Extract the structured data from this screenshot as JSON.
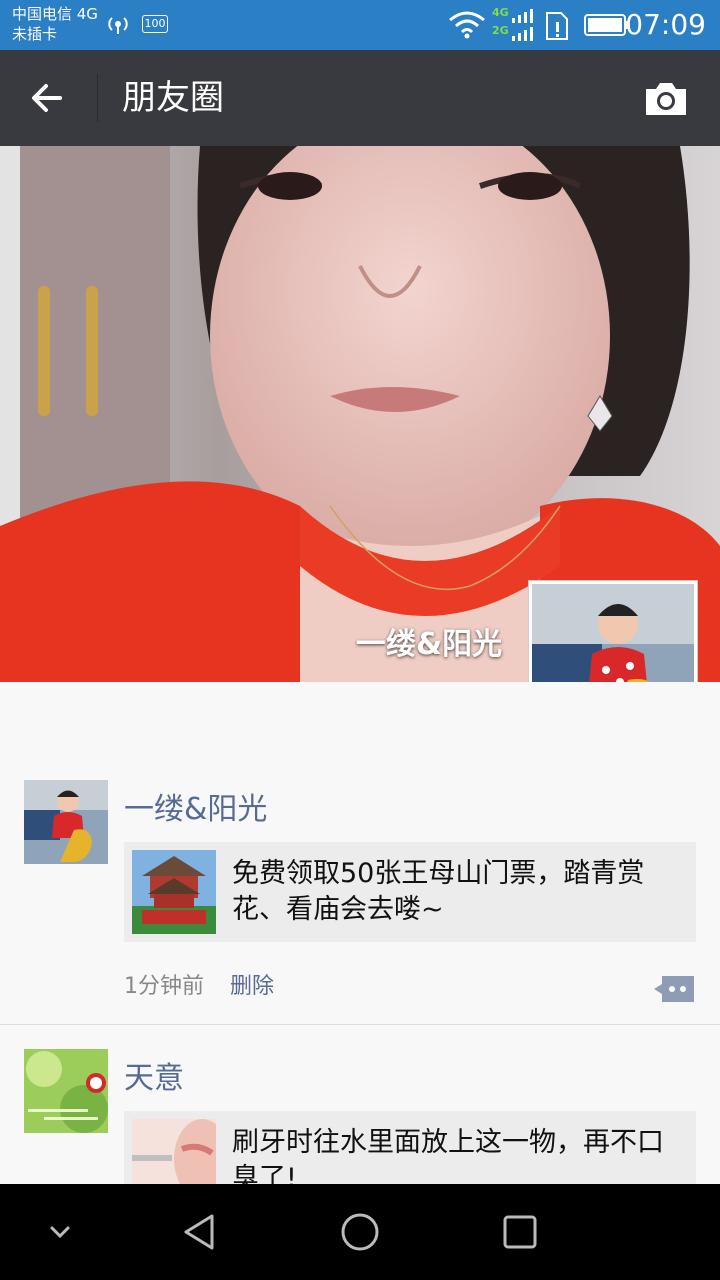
{
  "status_bar": {
    "carrier_line1": "中国电信 4G",
    "carrier_line2": "未插卡",
    "battery_small": "100",
    "network_4g": "4G",
    "network_2g": "2G",
    "time": "07:09"
  },
  "app_bar": {
    "title": "朋友圈"
  },
  "cover": {
    "user_name": "一缕&阳光"
  },
  "posts": [
    {
      "author": "一缕&阳光",
      "card_text": "免费领取50张王母山门票，踏青赏花、看庙会去喽~",
      "time": "1分钟前",
      "delete_label": "删除"
    },
    {
      "author": "天意",
      "card_text": "刷牙时往水里面放上这一物，再不口臭了!"
    }
  ],
  "colors": {
    "status_bar": "#2b7fc4",
    "app_bar": "#393a3f",
    "link_blue": "#576b95",
    "nav_bar": "#000000"
  }
}
